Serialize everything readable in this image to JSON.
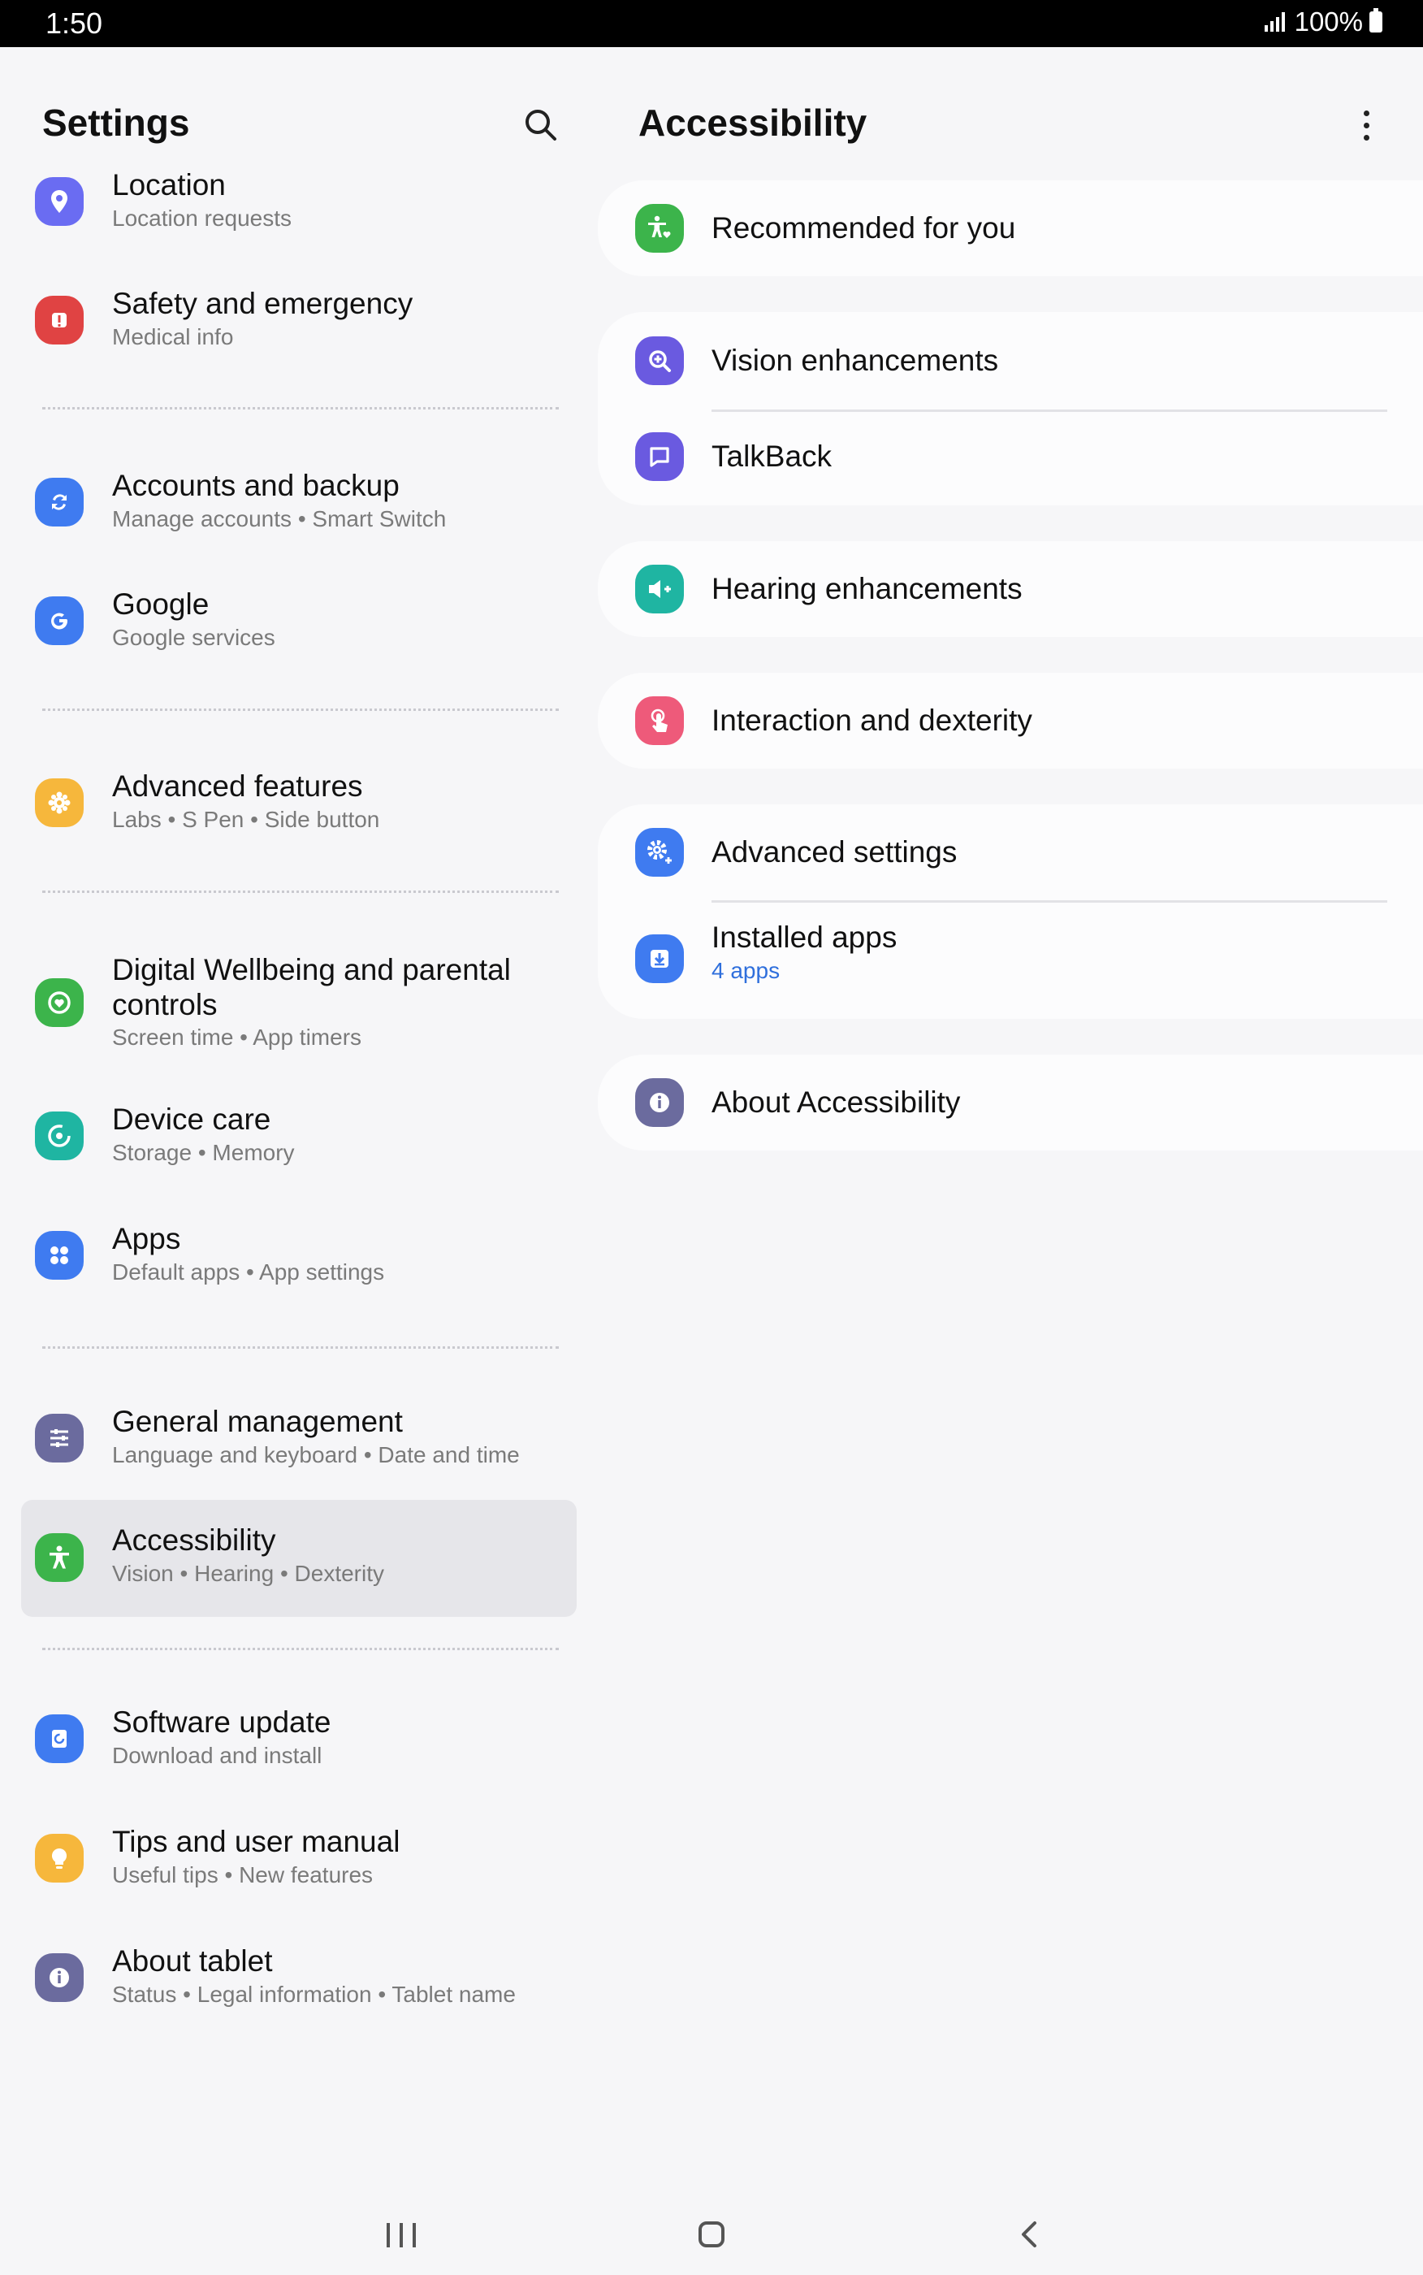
{
  "status_bar": {
    "time": "1:50",
    "battery": "100%"
  },
  "left_panel": {
    "title": "Settings",
    "items": [
      {
        "title": "Location",
        "subtitle": "Location requests",
        "color": "#6a6cf2",
        "icon": "location-pin-icon"
      },
      {
        "title": "Safety and emergency",
        "subtitle": "Medical info",
        "color": "#e04343",
        "icon": "alert-icon"
      },
      {
        "title": "Accounts and backup",
        "subtitle": "Manage accounts  •  Smart Switch",
        "color": "#3f7bf0",
        "icon": "sync-icon"
      },
      {
        "title": "Google",
        "subtitle": "Google services",
        "color": "#3f7bf0",
        "icon": "google-icon"
      },
      {
        "title": "Advanced features",
        "subtitle": "Labs  •  S Pen  •  Side button",
        "color": "#f6b73c",
        "icon": "puzzle-icon"
      },
      {
        "title": "Digital Wellbeing and parental controls",
        "subtitle": "Screen time  •  App timers",
        "color": "#3cb44b",
        "icon": "heart-circle-icon"
      },
      {
        "title": "Device care",
        "subtitle": "Storage  •  Memory",
        "color": "#1fb5a2",
        "icon": "refresh-circle-icon"
      },
      {
        "title": "Apps",
        "subtitle": "Default apps  •  App settings",
        "color": "#3f7bf0",
        "icon": "grid-dots-icon"
      },
      {
        "title": "General management",
        "subtitle": "Language and keyboard  •  Date and time",
        "color": "#6b6b9e",
        "icon": "sliders-icon"
      },
      {
        "title": "Accessibility",
        "subtitle": "Vision  •  Hearing  •  Dexterity",
        "color": "#3cb44b",
        "icon": "accessibility-icon"
      },
      {
        "title": "Software update",
        "subtitle": "Download and install",
        "color": "#3f7bf0",
        "icon": "update-icon"
      },
      {
        "title": "Tips and user manual",
        "subtitle": "Useful tips  •  New features",
        "color": "#f6b73c",
        "icon": "lightbulb-icon"
      },
      {
        "title": "About tablet",
        "subtitle": "Status  •  Legal information  •  Tablet name",
        "color": "#6b6b9e",
        "icon": "info-icon"
      }
    ]
  },
  "right_panel": {
    "title": "Accessibility",
    "recommended": {
      "title": "Recommended for you",
      "color": "#3cb44b",
      "icon": "accessibility-heart-icon"
    },
    "vision": {
      "title": "Vision enhancements",
      "color": "#6a5ae0",
      "icon": "magnifier-icon"
    },
    "talkback": {
      "title": "TalkBack",
      "color": "#6a5ae0",
      "icon": "speech-bubble-icon"
    },
    "hearing": {
      "title": "Hearing enhancements",
      "color": "#1fb5a2",
      "icon": "speaker-icon"
    },
    "interaction": {
      "title": "Interaction and dexterity",
      "color": "#ee5a7a",
      "icon": "touch-icon"
    },
    "advanced": {
      "title": "Advanced settings",
      "color": "#3f7bf0",
      "icon": "gear-plus-icon"
    },
    "installed": {
      "title": "Installed apps",
      "subtitle": "4 apps",
      "color": "#3f7bf0",
      "icon": "download-box-icon"
    },
    "about": {
      "title": "About Accessibility",
      "color": "#6b6b9e",
      "icon": "info-icon"
    }
  }
}
